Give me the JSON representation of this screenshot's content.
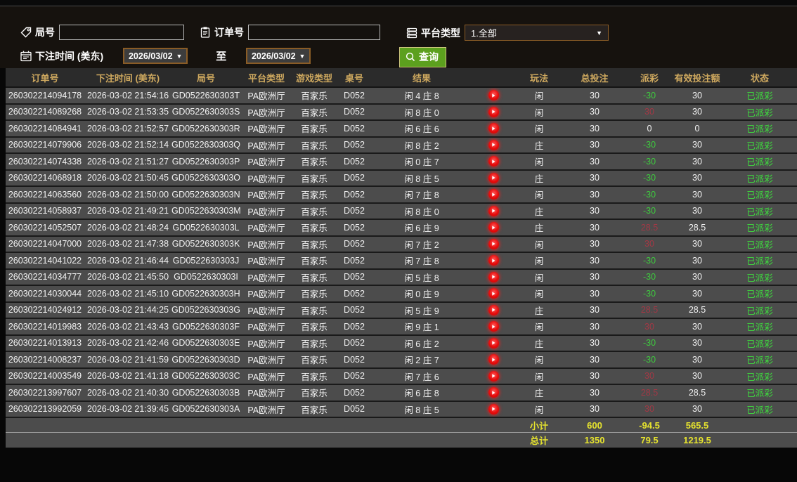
{
  "colors": {
    "header_gold": "#cfa95f",
    "payout_negative_green": "#3ecc3e",
    "payout_positive_red": "#a23845",
    "status_green": "#3edd3e",
    "totals_yellow": "#e6e32e",
    "search_button_green": "#5ca01e",
    "date_border_brown": "#8a5c26",
    "play_icon_red": "#e60c0c"
  },
  "filters": {
    "round_label": "局号",
    "round_value": "",
    "order_label": "订单号",
    "order_value": "",
    "platform_label": "平台类型",
    "platform_value": "1.全部",
    "bet_time_label": "下注时间 (美东)",
    "date_from": "2026/03/02",
    "date_to": "2026/03/02",
    "to_label": "至",
    "search_label": "查询"
  },
  "table": {
    "headers": [
      "订单号",
      "下注时间 (美东)",
      "局号",
      "平台类型",
      "游戏类型",
      "桌号",
      "结果",
      "",
      "玩法",
      "总投注",
      "派彩",
      "有效投注额",
      "状态"
    ],
    "rows": [
      {
        "order": "260302214094178",
        "time": "2026-03-02 21:54:16",
        "round": "GD0522630303T",
        "platform": "PA欧洲厅",
        "game": "百家乐",
        "table_no": "D052",
        "result": "闲 4 庄 8",
        "play": "闲",
        "bet": "30",
        "payout": "-30",
        "payout_class": "neg",
        "valid": "30",
        "status": "已派彩"
      },
      {
        "order": "260302214089268",
        "time": "2026-03-02 21:53:35",
        "round": "GD0522630303S",
        "platform": "PA欧洲厅",
        "game": "百家乐",
        "table_no": "D052",
        "result": "闲 8 庄 0",
        "play": "闲",
        "bet": "30",
        "payout": "30",
        "payout_class": "pos",
        "valid": "30",
        "status": "已派彩"
      },
      {
        "order": "260302214084941",
        "time": "2026-03-02 21:52:57",
        "round": "GD0522630303R",
        "platform": "PA欧洲厅",
        "game": "百家乐",
        "table_no": "D052",
        "result": "闲 6 庄 6",
        "play": "闲",
        "bet": "30",
        "payout": "0",
        "payout_class": "zero",
        "valid": "0",
        "status": "已派彩"
      },
      {
        "order": "260302214079906",
        "time": "2026-03-02 21:52:14",
        "round": "GD0522630303Q",
        "platform": "PA欧洲厅",
        "game": "百家乐",
        "table_no": "D052",
        "result": "闲 8 庄 2",
        "play": "庄",
        "bet": "30",
        "payout": "-30",
        "payout_class": "neg",
        "valid": "30",
        "status": "已派彩"
      },
      {
        "order": "260302214074338",
        "time": "2026-03-02 21:51:27",
        "round": "GD0522630303P",
        "platform": "PA欧洲厅",
        "game": "百家乐",
        "table_no": "D052",
        "result": "闲 0 庄 7",
        "play": "闲",
        "bet": "30",
        "payout": "-30",
        "payout_class": "neg",
        "valid": "30",
        "status": "已派彩"
      },
      {
        "order": "260302214068918",
        "time": "2026-03-02 21:50:45",
        "round": "GD0522630303O",
        "platform": "PA欧洲厅",
        "game": "百家乐",
        "table_no": "D052",
        "result": "闲 8 庄 5",
        "play": "庄",
        "bet": "30",
        "payout": "-30",
        "payout_class": "neg",
        "valid": "30",
        "status": "已派彩"
      },
      {
        "order": "260302214063560",
        "time": "2026-03-02 21:50:00",
        "round": "GD0522630303N",
        "platform": "PA欧洲厅",
        "game": "百家乐",
        "table_no": "D052",
        "result": "闲 7 庄 8",
        "play": "闲",
        "bet": "30",
        "payout": "-30",
        "payout_class": "neg",
        "valid": "30",
        "status": "已派彩"
      },
      {
        "order": "260302214058937",
        "time": "2026-03-02 21:49:21",
        "round": "GD0522630303M",
        "platform": "PA欧洲厅",
        "game": "百家乐",
        "table_no": "D052",
        "result": "闲 8 庄 0",
        "play": "庄",
        "bet": "30",
        "payout": "-30",
        "payout_class": "neg",
        "valid": "30",
        "status": "已派彩"
      },
      {
        "order": "260302214052507",
        "time": "2026-03-02 21:48:24",
        "round": "GD0522630303L",
        "platform": "PA欧洲厅",
        "game": "百家乐",
        "table_no": "D052",
        "result": "闲 6 庄 9",
        "play": "庄",
        "bet": "30",
        "payout": "28.5",
        "payout_class": "pos",
        "valid": "28.5",
        "status": "已派彩"
      },
      {
        "order": "260302214047000",
        "time": "2026-03-02 21:47:38",
        "round": "GD0522630303K",
        "platform": "PA欧洲厅",
        "game": "百家乐",
        "table_no": "D052",
        "result": "闲 7 庄 2",
        "play": "闲",
        "bet": "30",
        "payout": "30",
        "payout_class": "pos",
        "valid": "30",
        "status": "已派彩"
      },
      {
        "order": "260302214041022",
        "time": "2026-03-02 21:46:44",
        "round": "GD0522630303J",
        "platform": "PA欧洲厅",
        "game": "百家乐",
        "table_no": "D052",
        "result": "闲 7 庄 8",
        "play": "闲",
        "bet": "30",
        "payout": "-30",
        "payout_class": "neg",
        "valid": "30",
        "status": "已派彩"
      },
      {
        "order": "260302214034777",
        "time": "2026-03-02 21:45:50",
        "round": "GD0522630303I",
        "platform": "PA欧洲厅",
        "game": "百家乐",
        "table_no": "D052",
        "result": "闲 5 庄 8",
        "play": "闲",
        "bet": "30",
        "payout": "-30",
        "payout_class": "neg",
        "valid": "30",
        "status": "已派彩"
      },
      {
        "order": "260302214030044",
        "time": "2026-03-02 21:45:10",
        "round": "GD0522630303H",
        "platform": "PA欧洲厅",
        "game": "百家乐",
        "table_no": "D052",
        "result": "闲 0 庄 9",
        "play": "闲",
        "bet": "30",
        "payout": "-30",
        "payout_class": "neg",
        "valid": "30",
        "status": "已派彩"
      },
      {
        "order": "260302214024912",
        "time": "2026-03-02 21:44:25",
        "round": "GD0522630303G",
        "platform": "PA欧洲厅",
        "game": "百家乐",
        "table_no": "D052",
        "result": "闲 5 庄 9",
        "play": "庄",
        "bet": "30",
        "payout": "28.5",
        "payout_class": "pos",
        "valid": "28.5",
        "status": "已派彩"
      },
      {
        "order": "260302214019983",
        "time": "2026-03-02 21:43:43",
        "round": "GD0522630303F",
        "platform": "PA欧洲厅",
        "game": "百家乐",
        "table_no": "D052",
        "result": "闲 9 庄 1",
        "play": "闲",
        "bet": "30",
        "payout": "30",
        "payout_class": "pos",
        "valid": "30",
        "status": "已派彩"
      },
      {
        "order": "260302214013913",
        "time": "2026-03-02 21:42:46",
        "round": "GD0522630303E",
        "platform": "PA欧洲厅",
        "game": "百家乐",
        "table_no": "D052",
        "result": "闲 6 庄 2",
        "play": "庄",
        "bet": "30",
        "payout": "-30",
        "payout_class": "neg",
        "valid": "30",
        "status": "已派彩"
      },
      {
        "order": "260302214008237",
        "time": "2026-03-02 21:41:59",
        "round": "GD0522630303D",
        "platform": "PA欧洲厅",
        "game": "百家乐",
        "table_no": "D052",
        "result": "闲 2 庄 7",
        "play": "闲",
        "bet": "30",
        "payout": "-30",
        "payout_class": "neg",
        "valid": "30",
        "status": "已派彩"
      },
      {
        "order": "260302214003549",
        "time": "2026-03-02 21:41:18",
        "round": "GD0522630303C",
        "platform": "PA欧洲厅",
        "game": "百家乐",
        "table_no": "D052",
        "result": "闲 7 庄 6",
        "play": "闲",
        "bet": "30",
        "payout": "30",
        "payout_class": "pos",
        "valid": "30",
        "status": "已派彩"
      },
      {
        "order": "260302213997607",
        "time": "2026-03-02 21:40:30",
        "round": "GD0522630303B",
        "platform": "PA欧洲厅",
        "game": "百家乐",
        "table_no": "D052",
        "result": "闲 6 庄 8",
        "play": "庄",
        "bet": "30",
        "payout": "28.5",
        "payout_class": "pos",
        "valid": "28.5",
        "status": "已派彩"
      },
      {
        "order": "260302213992059",
        "time": "2026-03-02 21:39:45",
        "round": "GD0522630303A",
        "platform": "PA欧洲厅",
        "game": "百家乐",
        "table_no": "D052",
        "result": "闲 8 庄 5",
        "play": "闲",
        "bet": "30",
        "payout": "30",
        "payout_class": "pos",
        "valid": "30",
        "status": "已派彩"
      }
    ],
    "subtotal": {
      "label": "小计",
      "bet": "600",
      "payout": "-94.5",
      "valid": "565.5"
    },
    "total": {
      "label": "总计",
      "bet": "1350",
      "payout": "79.5",
      "valid": "1219.5"
    }
  }
}
